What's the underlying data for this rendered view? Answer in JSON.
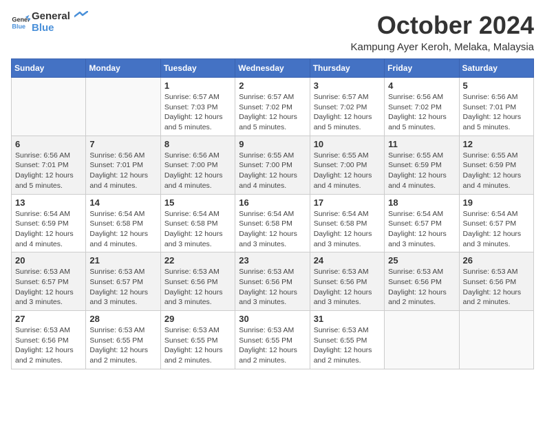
{
  "logo": {
    "line1": "General",
    "line2": "Blue"
  },
  "title": "October 2024",
  "location": "Kampung Ayer Keroh, Melaka, Malaysia",
  "headers": [
    "Sunday",
    "Monday",
    "Tuesday",
    "Wednesday",
    "Thursday",
    "Friday",
    "Saturday"
  ],
  "weeks": [
    [
      {
        "day": "",
        "info": ""
      },
      {
        "day": "",
        "info": ""
      },
      {
        "day": "1",
        "info": "Sunrise: 6:57 AM\nSunset: 7:03 PM\nDaylight: 12 hours\nand 5 minutes."
      },
      {
        "day": "2",
        "info": "Sunrise: 6:57 AM\nSunset: 7:02 PM\nDaylight: 12 hours\nand 5 minutes."
      },
      {
        "day": "3",
        "info": "Sunrise: 6:57 AM\nSunset: 7:02 PM\nDaylight: 12 hours\nand 5 minutes."
      },
      {
        "day": "4",
        "info": "Sunrise: 6:56 AM\nSunset: 7:02 PM\nDaylight: 12 hours\nand 5 minutes."
      },
      {
        "day": "5",
        "info": "Sunrise: 6:56 AM\nSunset: 7:01 PM\nDaylight: 12 hours\nand 5 minutes."
      }
    ],
    [
      {
        "day": "6",
        "info": "Sunrise: 6:56 AM\nSunset: 7:01 PM\nDaylight: 12 hours\nand 5 minutes."
      },
      {
        "day": "7",
        "info": "Sunrise: 6:56 AM\nSunset: 7:01 PM\nDaylight: 12 hours\nand 4 minutes."
      },
      {
        "day": "8",
        "info": "Sunrise: 6:56 AM\nSunset: 7:00 PM\nDaylight: 12 hours\nand 4 minutes."
      },
      {
        "day": "9",
        "info": "Sunrise: 6:55 AM\nSunset: 7:00 PM\nDaylight: 12 hours\nand 4 minutes."
      },
      {
        "day": "10",
        "info": "Sunrise: 6:55 AM\nSunset: 7:00 PM\nDaylight: 12 hours\nand 4 minutes."
      },
      {
        "day": "11",
        "info": "Sunrise: 6:55 AM\nSunset: 6:59 PM\nDaylight: 12 hours\nand 4 minutes."
      },
      {
        "day": "12",
        "info": "Sunrise: 6:55 AM\nSunset: 6:59 PM\nDaylight: 12 hours\nand 4 minutes."
      }
    ],
    [
      {
        "day": "13",
        "info": "Sunrise: 6:54 AM\nSunset: 6:59 PM\nDaylight: 12 hours\nand 4 minutes."
      },
      {
        "day": "14",
        "info": "Sunrise: 6:54 AM\nSunset: 6:58 PM\nDaylight: 12 hours\nand 4 minutes."
      },
      {
        "day": "15",
        "info": "Sunrise: 6:54 AM\nSunset: 6:58 PM\nDaylight: 12 hours\nand 3 minutes."
      },
      {
        "day": "16",
        "info": "Sunrise: 6:54 AM\nSunset: 6:58 PM\nDaylight: 12 hours\nand 3 minutes."
      },
      {
        "day": "17",
        "info": "Sunrise: 6:54 AM\nSunset: 6:58 PM\nDaylight: 12 hours\nand 3 minutes."
      },
      {
        "day": "18",
        "info": "Sunrise: 6:54 AM\nSunset: 6:57 PM\nDaylight: 12 hours\nand 3 minutes."
      },
      {
        "day": "19",
        "info": "Sunrise: 6:54 AM\nSunset: 6:57 PM\nDaylight: 12 hours\nand 3 minutes."
      }
    ],
    [
      {
        "day": "20",
        "info": "Sunrise: 6:53 AM\nSunset: 6:57 PM\nDaylight: 12 hours\nand 3 minutes."
      },
      {
        "day": "21",
        "info": "Sunrise: 6:53 AM\nSunset: 6:57 PM\nDaylight: 12 hours\nand 3 minutes."
      },
      {
        "day": "22",
        "info": "Sunrise: 6:53 AM\nSunset: 6:56 PM\nDaylight: 12 hours\nand 3 minutes."
      },
      {
        "day": "23",
        "info": "Sunrise: 6:53 AM\nSunset: 6:56 PM\nDaylight: 12 hours\nand 3 minutes."
      },
      {
        "day": "24",
        "info": "Sunrise: 6:53 AM\nSunset: 6:56 PM\nDaylight: 12 hours\nand 3 minutes."
      },
      {
        "day": "25",
        "info": "Sunrise: 6:53 AM\nSunset: 6:56 PM\nDaylight: 12 hours\nand 2 minutes."
      },
      {
        "day": "26",
        "info": "Sunrise: 6:53 AM\nSunset: 6:56 PM\nDaylight: 12 hours\nand 2 minutes."
      }
    ],
    [
      {
        "day": "27",
        "info": "Sunrise: 6:53 AM\nSunset: 6:56 PM\nDaylight: 12 hours\nand 2 minutes."
      },
      {
        "day": "28",
        "info": "Sunrise: 6:53 AM\nSunset: 6:55 PM\nDaylight: 12 hours\nand 2 minutes."
      },
      {
        "day": "29",
        "info": "Sunrise: 6:53 AM\nSunset: 6:55 PM\nDaylight: 12 hours\nand 2 minutes."
      },
      {
        "day": "30",
        "info": "Sunrise: 6:53 AM\nSunset: 6:55 PM\nDaylight: 12 hours\nand 2 minutes."
      },
      {
        "day": "31",
        "info": "Sunrise: 6:53 AM\nSunset: 6:55 PM\nDaylight: 12 hours\nand 2 minutes."
      },
      {
        "day": "",
        "info": ""
      },
      {
        "day": "",
        "info": ""
      }
    ]
  ]
}
